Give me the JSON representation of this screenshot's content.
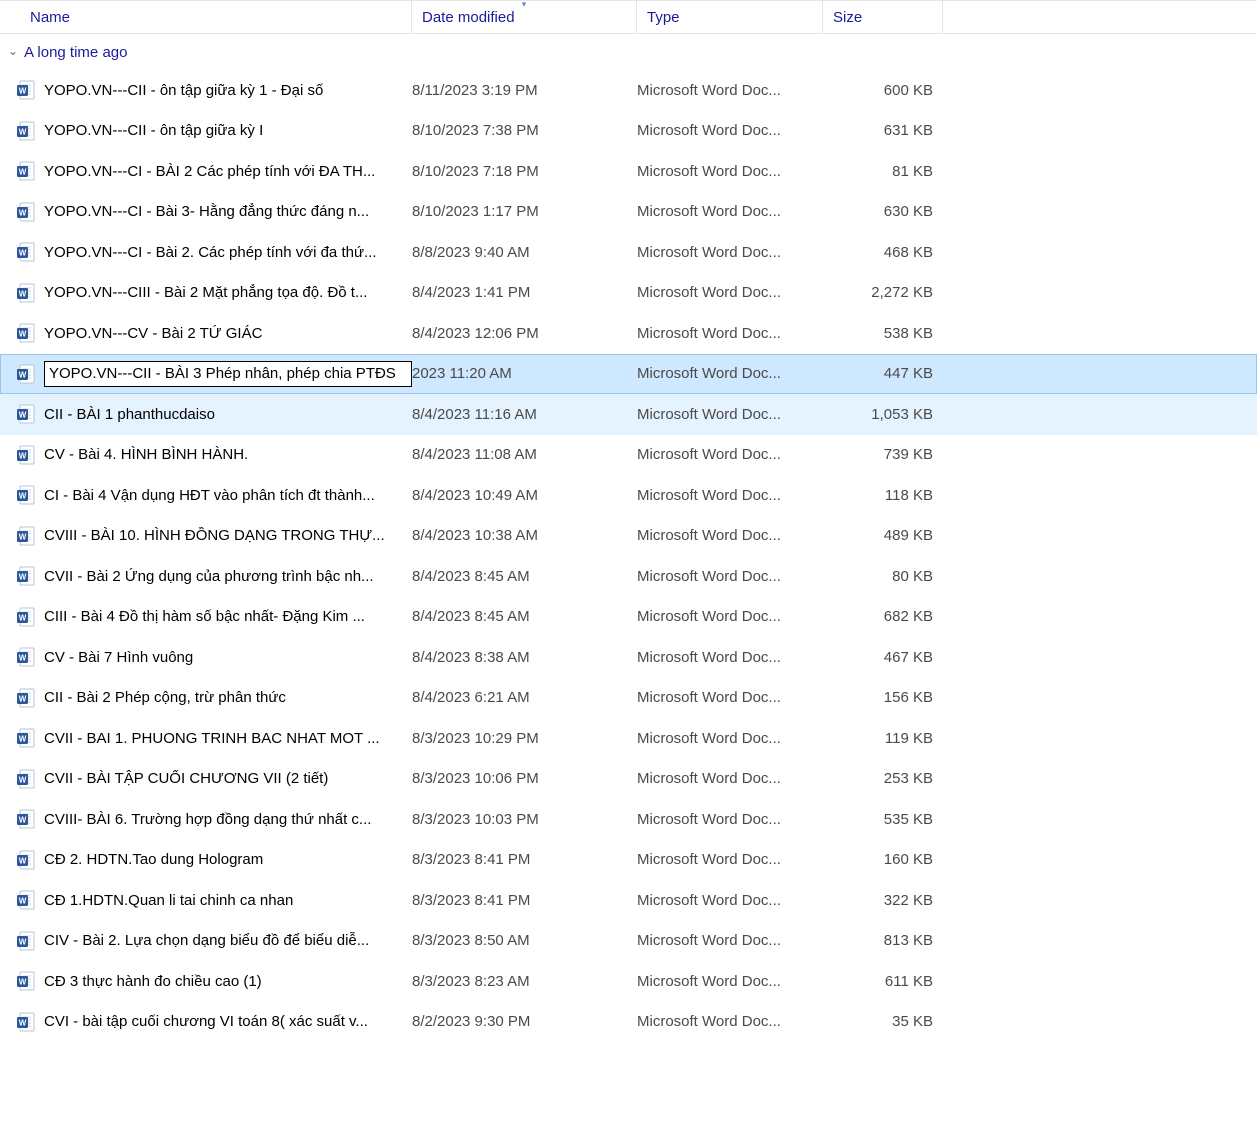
{
  "columns": {
    "name": "Name",
    "date": "Date modified",
    "type": "Type",
    "size": "Size"
  },
  "group": {
    "label": "A long time ago"
  },
  "rename_value": "YOPO.VN---CII - BÀI 3 Phép nhân, phép chia PTĐS",
  "files": [
    {
      "name": "YOPO.VN---CII - ôn tập giữa kỳ 1 - Đại số",
      "date": "8/11/2023 3:19 PM",
      "type": "Microsoft Word Doc...",
      "size": "600 KB",
      "state": ""
    },
    {
      "name": "YOPO.VN---CII - ôn tập giữa  kỳ I",
      "date": "8/10/2023 7:38 PM",
      "type": "Microsoft Word Doc...",
      "size": "631 KB",
      "state": ""
    },
    {
      "name": "YOPO.VN---CI - BÀI 2 Các phép tính với  ĐA TH...",
      "date": "8/10/2023 7:18 PM",
      "type": "Microsoft Word Doc...",
      "size": "81 KB",
      "state": ""
    },
    {
      "name": "YOPO.VN---CI - Bài 3- Hằng đẳng thức đáng n...",
      "date": "8/10/2023 1:17 PM",
      "type": "Microsoft Word Doc...",
      "size": "630 KB",
      "state": ""
    },
    {
      "name": "YOPO.VN---CI - Bài 2. Các phép tính với đa thứ...",
      "date": "8/8/2023 9:40 AM",
      "type": "Microsoft Word Doc...",
      "size": "468 KB",
      "state": ""
    },
    {
      "name": "YOPO.VN---CIII - Bài 2 Mặt phẳng tọa độ. Đồ t...",
      "date": "8/4/2023 1:41 PM",
      "type": "Microsoft Word Doc...",
      "size": "2,272 KB",
      "state": ""
    },
    {
      "name": "YOPO.VN---CV - Bài 2 TỨ GIÁC",
      "date": "8/4/2023 12:06 PM",
      "type": "Microsoft Word Doc...",
      "size": "538 KB",
      "state": ""
    },
    {
      "name": "",
      "date": "2023 11:20 AM",
      "type": "Microsoft Word Doc...",
      "size": "447 KB",
      "state": "rename"
    },
    {
      "name": "CII - BÀI 1 phanthucdaiso",
      "date": "8/4/2023 11:16 AM",
      "type": "Microsoft Word Doc...",
      "size": "1,053 KB",
      "state": "hover"
    },
    {
      "name": "CV - Bài 4. HÌNH BÌNH HÀNH.",
      "date": "8/4/2023 11:08 AM",
      "type": "Microsoft Word Doc...",
      "size": "739 KB",
      "state": ""
    },
    {
      "name": "CI - Bài 4 Vận dụng HĐT vào phân tích đt thành...",
      "date": "8/4/2023 10:49 AM",
      "type": "Microsoft Word Doc...",
      "size": "118 KB",
      "state": ""
    },
    {
      "name": "CVIII - BÀI 10. HÌNH ĐỒNG DẠNG TRONG THỰ...",
      "date": "8/4/2023 10:38 AM",
      "type": "Microsoft Word Doc...",
      "size": "489 KB",
      "state": ""
    },
    {
      "name": "CVII - Bài 2  Ứng dụng của phương trình bậc nh...",
      "date": "8/4/2023 8:45 AM",
      "type": "Microsoft Word Doc...",
      "size": "80 KB",
      "state": ""
    },
    {
      "name": "CIII - Bài 4 Đồ thị hàm số bậc nhất- Đặng Kim ...",
      "date": "8/4/2023 8:45 AM",
      "type": "Microsoft Word Doc...",
      "size": "682 KB",
      "state": ""
    },
    {
      "name": "CV - Bài 7 Hình vuông",
      "date": "8/4/2023 8:38 AM",
      "type": "Microsoft Word Doc...",
      "size": "467 KB",
      "state": ""
    },
    {
      "name": "CII - Bài 2 Phép cộng, trừ phân thức",
      "date": "8/4/2023 6:21 AM",
      "type": "Microsoft Word Doc...",
      "size": "156 KB",
      "state": ""
    },
    {
      "name": "CVII - BAI 1. PHUONG TRINH BAC NHAT MOT ...",
      "date": "8/3/2023 10:29 PM",
      "type": "Microsoft Word Doc...",
      "size": "119 KB",
      "state": ""
    },
    {
      "name": "CVII - BÀI TẬP CUỐI CHƯƠNG VII (2 tiết)",
      "date": "8/3/2023 10:06 PM",
      "type": "Microsoft Word Doc...",
      "size": "253 KB",
      "state": ""
    },
    {
      "name": "CVIII- BÀI 6. Trường hợp đồng dạng thứ nhất c...",
      "date": "8/3/2023 10:03 PM",
      "type": "Microsoft Word Doc...",
      "size": "535 KB",
      "state": ""
    },
    {
      "name": "CĐ 2. HDTN.Tao dung Hologram",
      "date": "8/3/2023 8:41 PM",
      "type": "Microsoft Word Doc...",
      "size": "160 KB",
      "state": ""
    },
    {
      "name": "CĐ 1.HDTN.Quan li tai chinh ca nhan",
      "date": "8/3/2023 8:41 PM",
      "type": "Microsoft Word Doc...",
      "size": "322 KB",
      "state": ""
    },
    {
      "name": "CIV -  Bài 2. Lựa chọn dạng biểu đồ để biểu diễ...",
      "date": "8/3/2023 8:50 AM",
      "type": "Microsoft Word Doc...",
      "size": "813 KB",
      "state": ""
    },
    {
      "name": "CĐ 3  thực hành đo chiều cao (1)",
      "date": "8/3/2023 8:23 AM",
      "type": "Microsoft Word Doc...",
      "size": "611 KB",
      "state": ""
    },
    {
      "name": "CVI - bài tập cuối chương VI toán 8( xác suất v...",
      "date": "8/2/2023 9:30 PM",
      "type": "Microsoft Word Doc...",
      "size": "35 KB",
      "state": ""
    }
  ]
}
